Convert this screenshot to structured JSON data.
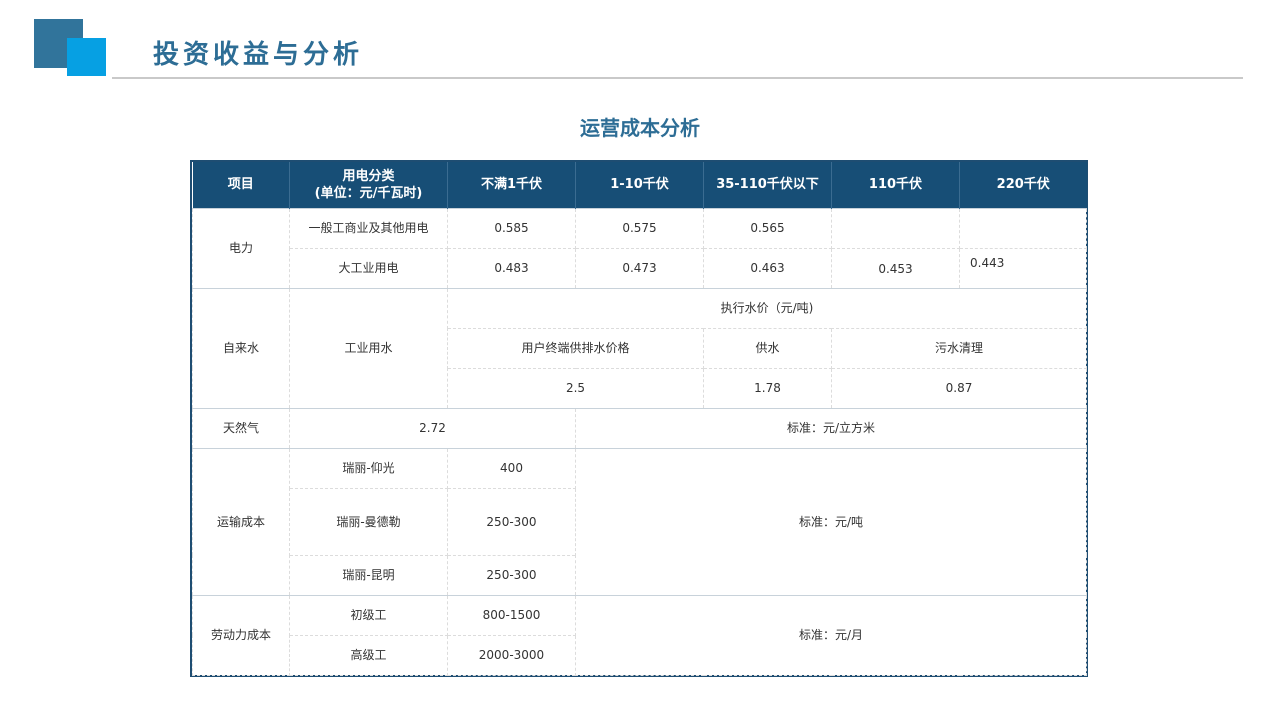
{
  "header": {
    "title": "投资收益与分析"
  },
  "table_title": "运营成本分析",
  "columns": [
    "项目",
    "用电分类",
    "(单位：元/千瓦时)",
    "不满1千伏",
    "1-10千伏",
    "35-110千伏以下",
    "110千伏",
    "220千伏"
  ],
  "electricity": {
    "label": "电力",
    "row1": {
      "type": "一般工商业及其他用电",
      "v1": "0.585",
      "v2": "0.575",
      "v3": "0.565"
    },
    "row2": {
      "type": "大工业用电",
      "v1": "0.483",
      "v2": "0.473",
      "v3": "0.463",
      "v4": "0.453",
      "v5": "0.443"
    }
  },
  "water": {
    "label": "自来水",
    "type": "工业用水",
    "price_header": "执行水价（元/吨)",
    "h1": "用户终端供排水价格",
    "h2": "供水",
    "h3": "污水清理",
    "v1": "2.5",
    "v2": "1.78",
    "v3": "0.87"
  },
  "gas": {
    "label": "天然气",
    "value": "2.72",
    "unit": "标准：元/立方米"
  },
  "transport": {
    "label": "运输成本",
    "rows": [
      {
        "route": "瑞丽-仰光",
        "cost": "400"
      },
      {
        "route": "瑞丽-曼德勒",
        "cost": "250-300"
      },
      {
        "route": "瑞丽-昆明",
        "cost": "250-300"
      }
    ],
    "unit": "标准：元/吨"
  },
  "labor": {
    "label": "劳动力成本",
    "rows": [
      {
        "grade": "初级工",
        "cost": "800-1500"
      },
      {
        "grade": "高级工",
        "cost": "2000-3000"
      }
    ],
    "unit": "标准：元/月"
  }
}
